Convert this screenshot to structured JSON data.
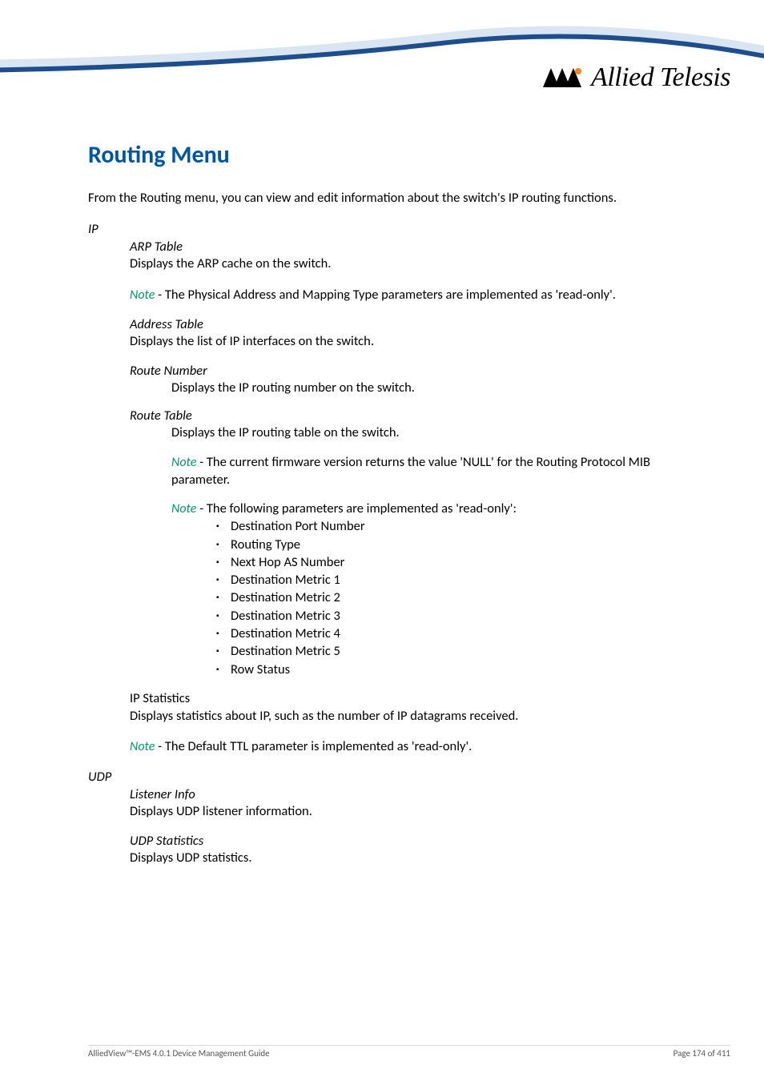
{
  "brand": "Allied Telesis",
  "heading": "Routing Menu",
  "intro": "From the Routing menu, you can view and edit information about the switch's IP routing functions.",
  "ip": {
    "label": "IP",
    "arp": {
      "title": "ARP Table",
      "body": "Displays the ARP cache on the switch.",
      "note": " - The Physical Address and Mapping Type parameters are implemented as 'read-only'."
    },
    "addr": {
      "title": "Address Table",
      "body": "Displays the list of IP interfaces on the switch."
    },
    "routenum": {
      "title": "Route Number",
      "body": "Displays the IP routing number on the switch."
    },
    "routetab": {
      "title": "Route Table",
      "body": "Displays the IP routing table on the switch.",
      "note1": " - The current firmware version returns the value 'NULL' for the Routing Protocol MIB parameter.",
      "note2": " - The following parameters are implemented as 'read-only':",
      "params": {
        "p0": "Destination Port Number",
        "p1": "Routing Type",
        "p2": "Next Hop AS Number",
        "p3": "Destination Metric 1",
        "p4": "Destination Metric 2",
        "p5": "Destination Metric 3",
        "p6": "Destination Metric 4",
        "p7": "Destination Metric 5",
        "p8": "Row Status"
      }
    },
    "stats": {
      "title": "IP Statistics",
      "body": "Displays statistics about IP, such as the number of IP datagrams received.",
      "note": " - The Default TTL parameter is implemented as 'read-only'."
    }
  },
  "udp": {
    "label": "UDP",
    "listener": {
      "title": "Listener Info",
      "body": "Displays UDP listener information."
    },
    "stats": {
      "title": "UDP Statistics",
      "body": "Displays UDP statistics."
    }
  },
  "note_word": "Note",
  "footer": {
    "left": "AlliedView™-EMS 4.0.1 Device Management Guide",
    "right": "Page 174 of 411"
  }
}
